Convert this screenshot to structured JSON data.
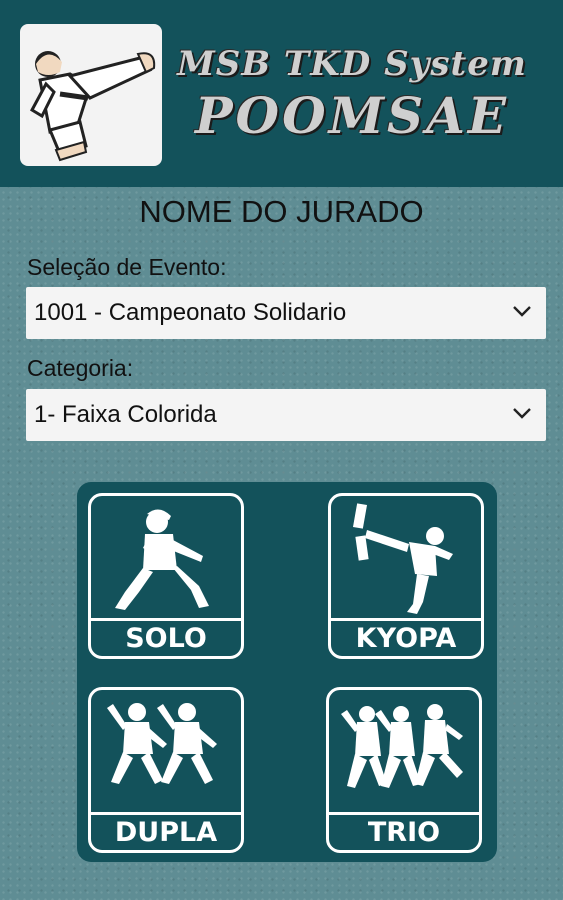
{
  "header": {
    "brand_line1": "MSB TKD System",
    "brand_line2": "POOMSAE"
  },
  "judge": {
    "name": "NOME DO JURADO"
  },
  "event": {
    "label": "Seleção de Evento:",
    "selected": "1001 - Campeonato Solidario"
  },
  "category": {
    "label": "Categoria:",
    "selected": "1- Faixa Colorida"
  },
  "modes": [
    {
      "label": "SOLO",
      "icon": "solo-figure-icon"
    },
    {
      "label": "KYOPA",
      "icon": "kyopa-board-break-icon"
    },
    {
      "label": "DUPLA",
      "icon": "dupla-pair-figures-icon"
    },
    {
      "label": "TRIO",
      "icon": "trio-group-figures-icon"
    }
  ],
  "colors": {
    "header_bg": "#13525b",
    "page_bg": "#5f8d94",
    "panel_bg": "#13525b",
    "tile_border": "#ffffff"
  }
}
